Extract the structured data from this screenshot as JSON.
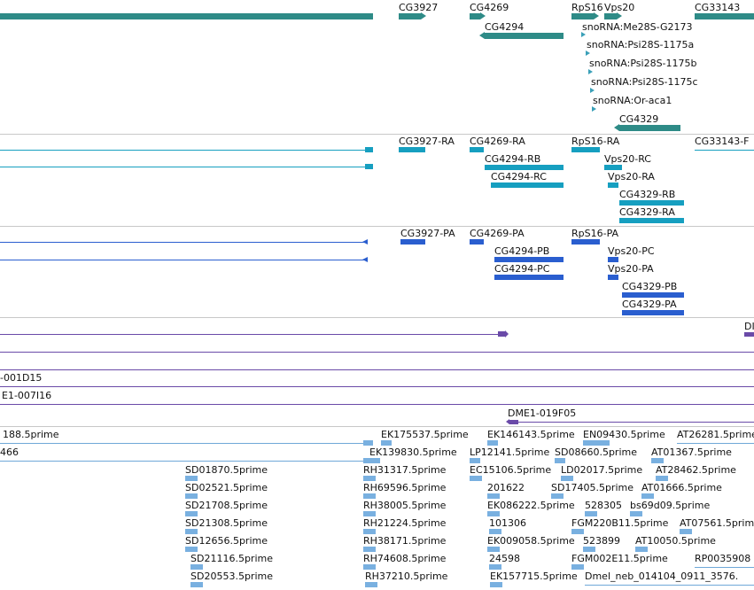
{
  "colors": {
    "gene": "#2e8b87",
    "transcript": "#169fc0",
    "protein": "#2a5ecf",
    "clone": "#6a4aa8",
    "est": "#79b0e0",
    "separator": "#c8c8c8"
  },
  "genes": {
    "cg3927": "CG3927",
    "cg4269": "CG4269",
    "rps16": "RpS16",
    "vps20": "Vps20",
    "cg33143": "CG33143",
    "cg4294": "CG4294",
    "sno1": "snoRNA:Me28S-G2173",
    "sno2": "snoRNA:Psi28S-1175a",
    "sno3": "snoRNA:Psi28S-1175b",
    "sno4": "snoRNA:Psi28S-1175c",
    "sno5": "snoRNA:Or-aca1",
    "cg4329": "CG4329"
  },
  "transcripts": {
    "cg3927_ra": "CG3927-RA",
    "cg4269_ra": "CG4269-RA",
    "rps16_ra": "RpS16-RA",
    "cg33143_r": "CG33143-F",
    "cg4294_rb": "CG4294-RB",
    "vps20_rc": "Vps20-RC",
    "cg4294_rc": "CG4294-RC",
    "vps20_ra": "Vps20-RA",
    "cg4329_rb": "CG4329-RB",
    "cg4329_ra": "CG4329-RA"
  },
  "proteins": {
    "cg3927_pa": "CG3927-PA",
    "cg4269_pa": "CG4269-PA",
    "rps16_pa": "RpS16-PA",
    "cg4294_pb": "CG4294-PB",
    "vps20_pc": "Vps20-PC",
    "cg4294_pc": "CG4294-PC",
    "vps20_pa": "Vps20-PA",
    "cg4329_pb": "CG4329-PB",
    "cg4329_pa": "CG4329-PA"
  },
  "clones": {
    "dm_right": "DI",
    "c1": "-001D15",
    "c2": "E1-007I16",
    "c3": "DME1-019F05"
  },
  "ests": {
    "top_left1": "188.5prime",
    "top_left2": "466",
    "ek175537": "EK175537.5prime",
    "ek146143": "EK146143.5prime",
    "en09430": "EN09430.5prime",
    "at26281": "AT26281.5prime",
    "ek139830": "EK139830.5prime",
    "lp12141": "LP12141.5prime",
    "sd08660": "SD08660.5prime",
    "at01367": "AT01367.5prime",
    "sd01870": "SD01870.5prime",
    "rh31317": "RH31317.5prime",
    "ec15106": "EC15106.5prime",
    "ld02017": "LD02017.5prime",
    "at28462": "AT28462.5prime",
    "sd02521": "SD02521.5prime",
    "rh69596": "RH69596.5prime",
    "n201622": "201622",
    "sd17405": "SD17405.5prime",
    "at01666": "AT01666.5prime",
    "sd21708": "SD21708.5prime",
    "rh38005": "RH38005.5prime",
    "ek086222": "EK086222.5prime",
    "n528305": "528305",
    "bs69d09": "bs69d09.5prime",
    "sd21308": "SD21308.5prime",
    "rh21224": "RH21224.5prime",
    "n101306": "101306",
    "fgm220b11": "FGM220B11.5prime",
    "at07561": "AT07561.5prime",
    "sd12656": "SD12656.5prime",
    "rh38171": "RH38171.5prime",
    "ek009058": "EK009058.5prime",
    "n523899": "523899",
    "at10050": "AT10050.5prime",
    "sd21116": "SD21116.5prime",
    "rh74608": "RH74608.5prime",
    "n24598": "24598",
    "fgm002e11": "FGM002E11.5prime",
    "rp003590": "RP0035908",
    "sd20553": "SD20553.5prime",
    "rh37210": "RH37210.5prime",
    "ek157715": "EK157715.5prime",
    "dmel_neb": "Dmel_neb_014104_0911_3576."
  }
}
